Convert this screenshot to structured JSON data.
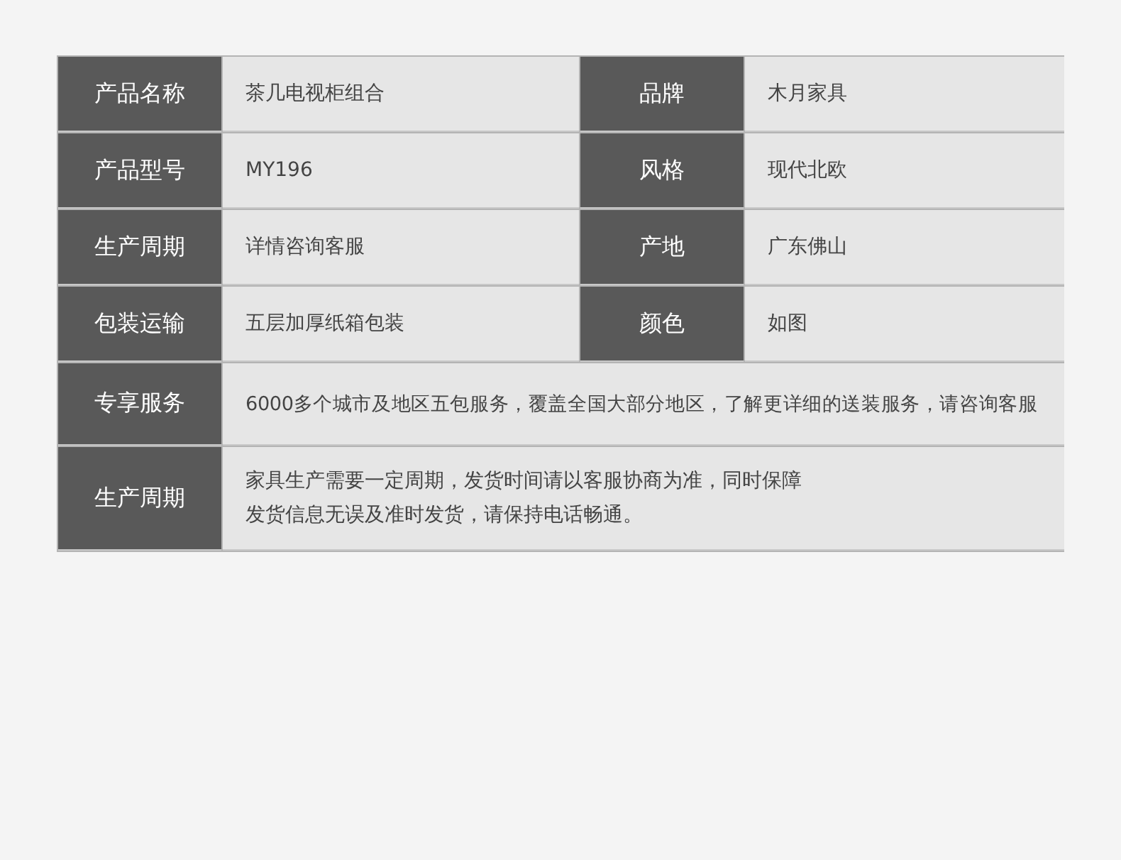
{
  "spec_table": {
    "rows": [
      {
        "kind": "pair",
        "cells": [
          {
            "label": "产品名称",
            "value": "茶几电视柜组合"
          },
          {
            "label": "品牌",
            "value": "木月家具"
          }
        ]
      },
      {
        "kind": "pair",
        "cells": [
          {
            "label": "产品型号",
            "value": "MY196"
          },
          {
            "label": "风格",
            "value": "现代北欧"
          }
        ]
      },
      {
        "kind": "pair",
        "cells": [
          {
            "label": "生产周期",
            "value": "详情咨询客服"
          },
          {
            "label": "产地",
            "value": "广东佛山"
          }
        ]
      },
      {
        "kind": "pair",
        "cells": [
          {
            "label": "包装运输",
            "value": "五层加厚纸箱包装"
          },
          {
            "label": "颜色",
            "value": "如图"
          }
        ]
      },
      {
        "kind": "wide",
        "label": "专享服务",
        "lines": [
          "6000多个城市及地区五包服务，覆盖全国大部分地区，了解更详细的送装服务，请咨询客服"
        ]
      },
      {
        "kind": "wide",
        "label": "生产周期",
        "lines": [
          "家具生产需要一定周期，发货时间请以客服协商为准，同时保障",
          "发货信息无误及准时发货，请保持电话畅通。"
        ]
      }
    ]
  }
}
